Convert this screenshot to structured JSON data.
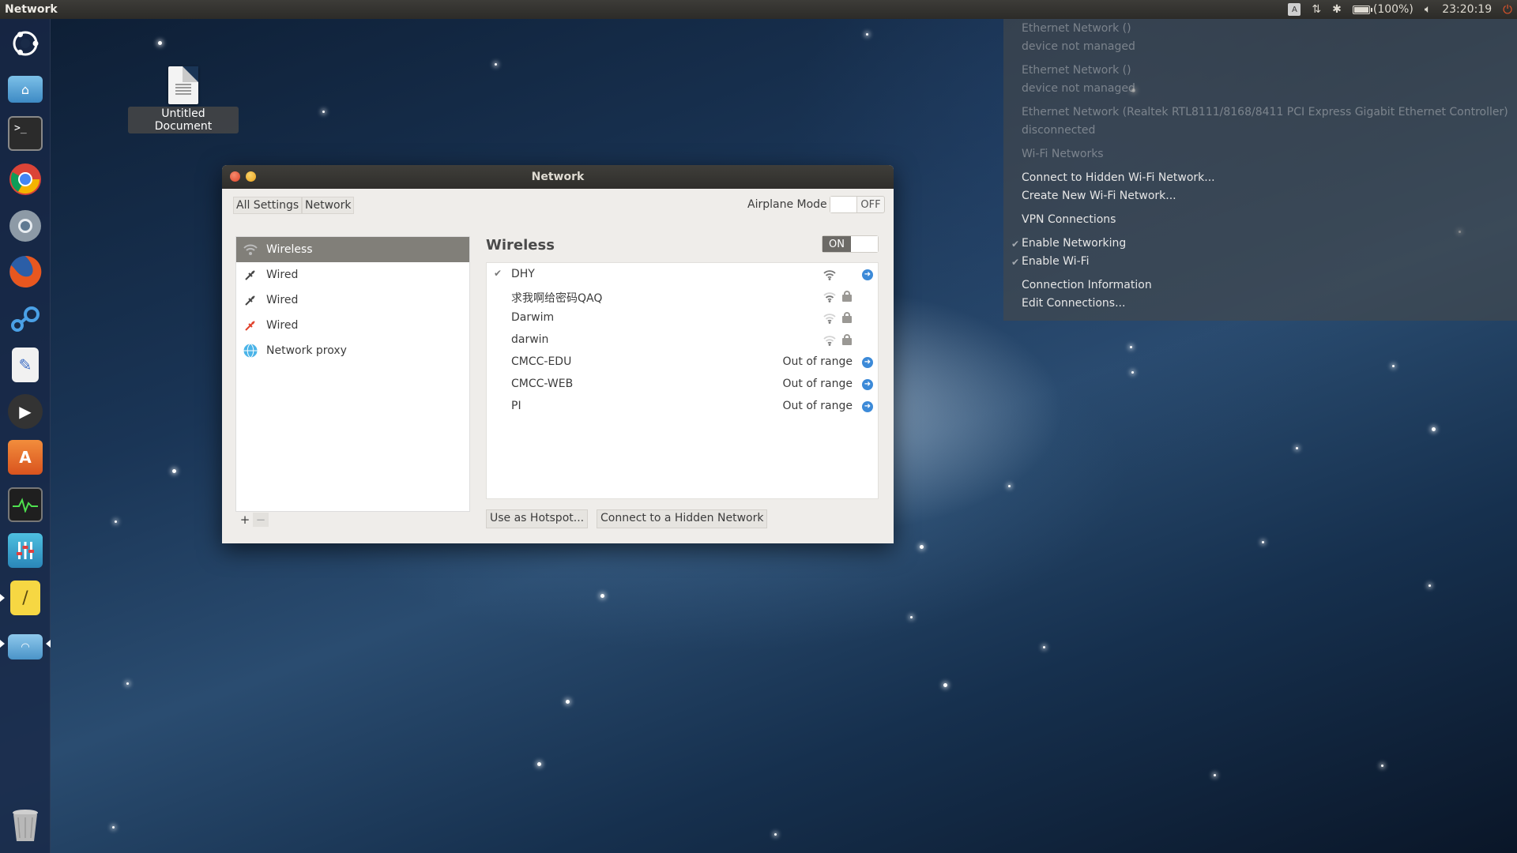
{
  "top_panel": {
    "title": "Network",
    "keyboard_indicator": "A",
    "battery_text": "(100%)",
    "clock": "23:20:19",
    "battery_level": 1.0
  },
  "desktop": {
    "icon_label": "Untitled Document"
  },
  "launcher": {
    "items": [
      "ubuntu-logo-icon",
      "home-folder-icon",
      "terminal-icon",
      "chrome-icon",
      "chromium-icon",
      "firefox-icon",
      "steam-icon",
      "text-editor-icon",
      "video-player-icon",
      "software-center-icon",
      "system-monitor-icon",
      "sound-mixer-icon",
      "notes-icon",
      "network-folder-icon",
      "trash-icon"
    ]
  },
  "network_menu": {
    "items": [
      {
        "label": "Ethernet Network ()",
        "dim": true
      },
      {
        "label": "device not managed",
        "dim": true
      },
      {
        "label": "Ethernet Network ()",
        "dim": true
      },
      {
        "label": "device not managed",
        "dim": true
      },
      {
        "label": "Ethernet Network (Realtek RTL8111/8168/8411 PCI Express Gigabit Ethernet Controller)",
        "dim": true
      },
      {
        "label": "disconnected",
        "dim": true
      },
      {
        "label": "Wi-Fi Networks",
        "dim": true
      },
      {
        "label": "Connect to Hidden Wi-Fi Network...",
        "dim": false
      },
      {
        "label": "Create New Wi-Fi Network...",
        "dim": false
      },
      {
        "label": "VPN Connections",
        "dim": false
      },
      {
        "label": "Enable Networking",
        "dim": false,
        "checked": true
      },
      {
        "label": "Enable Wi-Fi",
        "dim": false,
        "checked": true
      },
      {
        "label": "Connection Information",
        "dim": false
      },
      {
        "label": "Edit Connections...",
        "dim": false
      }
    ]
  },
  "window": {
    "title": "Network",
    "breadcrumb": [
      "All Settings",
      "Network"
    ],
    "airplane_label": "Airplane Mode",
    "airplane_state": "OFF",
    "sidebar": [
      {
        "label": "Wireless",
        "icon": "wireless-icon",
        "selected": true
      },
      {
        "label": "Wired",
        "icon": "wired-icon",
        "selected": false
      },
      {
        "label": "Wired",
        "icon": "wired-icon",
        "selected": false
      },
      {
        "label": "Wired",
        "icon": "wired-error-icon",
        "selected": false
      },
      {
        "label": "Network proxy",
        "icon": "globe-icon",
        "selected": false
      }
    ],
    "add_label": "+",
    "remove_label": "−",
    "panel_title": "Wireless",
    "wireless_state": "ON",
    "networks": [
      {
        "name": "DHY",
        "connected": true,
        "status": "",
        "signal": 0.9,
        "locked": false,
        "arrow": true
      },
      {
        "name": "求我啊给密码QAQ",
        "connected": false,
        "status": "",
        "signal": 0.75,
        "locked": true,
        "arrow": false
      },
      {
        "name": "Darwim",
        "connected": false,
        "status": "",
        "signal": 0.4,
        "locked": true,
        "arrow": false
      },
      {
        "name": "darwin",
        "connected": false,
        "status": "",
        "signal": 0.25,
        "locked": true,
        "arrow": false
      },
      {
        "name": "CMCC-EDU",
        "connected": false,
        "status": "Out of range",
        "signal": 0,
        "locked": false,
        "arrow": true
      },
      {
        "name": "CMCC-WEB",
        "connected": false,
        "status": "Out of range",
        "signal": 0,
        "locked": false,
        "arrow": true
      },
      {
        "name": "PI",
        "connected": false,
        "status": "Out of range",
        "signal": 0,
        "locked": false,
        "arrow": true
      }
    ],
    "hotspot_button": "Use as Hotspot...",
    "hidden_button": "Connect to a Hidden Network"
  }
}
